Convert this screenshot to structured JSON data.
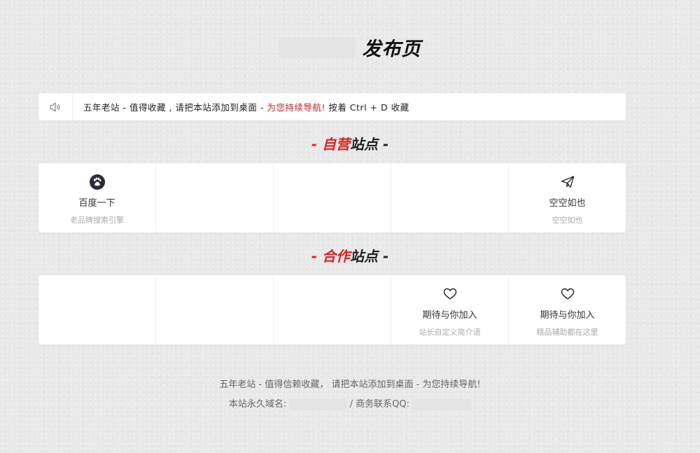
{
  "header": {
    "title": "发布页"
  },
  "notice": {
    "icon": "speaker-icon",
    "text_main": "五年老站 - 值得收藏 , 请把本站添加到桌面 - ",
    "text_red": "为您持续导航!",
    "text_end": " 按着 Ctrl + D 收藏"
  },
  "section_self": {
    "dash_left": "- ",
    "red": "自营",
    "dark": "站点",
    "dash_right": " -"
  },
  "self_sites": [
    {
      "icon": "baidu-paw-icon",
      "name": "百度一下",
      "desc": "老品牌搜索引擎"
    },
    {
      "icon": "",
      "name": "",
      "desc": ""
    },
    {
      "icon": "",
      "name": "",
      "desc": ""
    },
    {
      "icon": "",
      "name": "",
      "desc": ""
    },
    {
      "icon": "paper-plane-icon",
      "name": "空空如也",
      "desc": "空空如也"
    }
  ],
  "section_partner": {
    "dash_left": "- ",
    "red": "合作",
    "dark": "站点",
    "dash_right": " -"
  },
  "partner_sites": [
    {
      "icon": "",
      "name": "",
      "desc": ""
    },
    {
      "icon": "",
      "name": "",
      "desc": ""
    },
    {
      "icon": "",
      "name": "",
      "desc": ""
    },
    {
      "icon": "heart-icon",
      "name": "期待与你加入",
      "desc": "站长自定义简介语"
    },
    {
      "icon": "heart-icon",
      "name": "期待与你加入",
      "desc": "精品辅助都在这里"
    }
  ],
  "footer": {
    "line1": "五年老站 - 值得信赖收藏， 请把本站添加到桌面 - 为您持续导航!",
    "domain_label": "本站永久域名:",
    "separator": " / ",
    "qq_label": "商务联系QQ:"
  },
  "colors": {
    "accent": "#e02020",
    "background": "#e9e9e9",
    "card": "#ffffff"
  }
}
